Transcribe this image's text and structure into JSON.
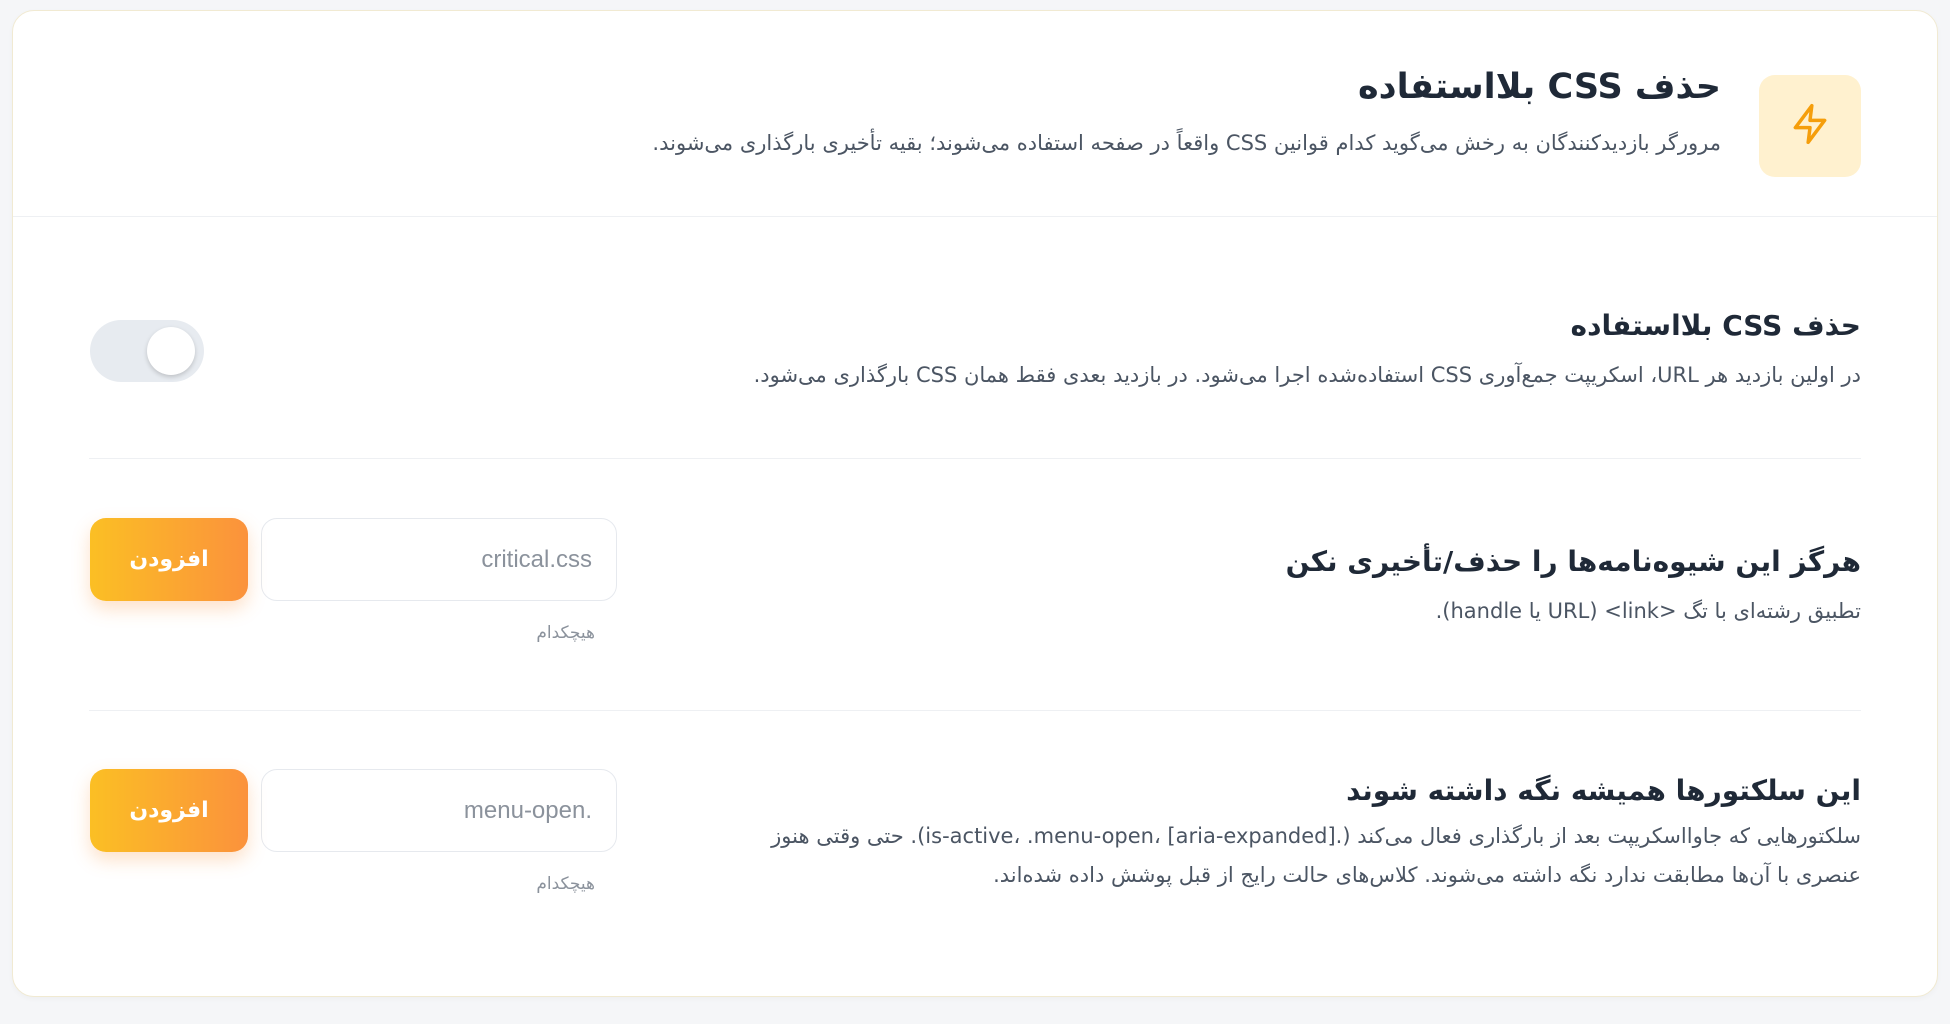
{
  "header": {
    "title": "حذف CSS بلااستفاده",
    "description": "مرورگر بازدیدکنندگان به رخش می‌گوید کدام قوانین CSS واقعاً در صفحه استفاده می‌شوند؛ بقیه تأخیری بارگذاری می‌شوند.",
    "icon": "lightning-bolt-icon",
    "icon_color": "#f59e0b",
    "icon_bg": "#fff1cf"
  },
  "settings": {
    "remove_unused": {
      "title": "حذف CSS بلااستفاده",
      "description": "در اولین بازدید هر URL، اسکریپت جمع‌آوری CSS استفاده‌شده اجرا می‌شود. در بازدید بعدی فقط همان CSS بارگذاری می‌شود.",
      "enabled": false
    },
    "exclude_stylesheets": {
      "title": "هرگز این شیوه‌نامه‌ها را حذف/تأخیری نکن",
      "description": "تطبیق رشته‌ای با تگ <link> (URL یا handle).",
      "input_placeholder": "critical.css",
      "input_value": "",
      "add_label": "افزودن",
      "empty_label": "هیچکدام"
    },
    "keep_selectors": {
      "title": "این سلکتورها همیشه نگه داشته شوند",
      "description_line1": "سلکتورهایی که جاوااسکریپت بعد از بارگذاری فعال می‌کند (.is-active، .menu-open، [aria-expanded]). حتی وقتی هنوز",
      "description_line2": "عنصری با آن‌ها مطابقت ندارد نگه داشته می‌شوند. کلاس‌های حالت رایج از قبل پوشش داده شده‌اند.",
      "input_placeholder": ".menu-open",
      "input_value": "",
      "add_label": "افزودن",
      "empty_label": "هیچکدام"
    }
  },
  "colors": {
    "accent_start": "#fbbf24",
    "accent_end": "#fb923c",
    "toggle_off": "#e7ebf0"
  }
}
